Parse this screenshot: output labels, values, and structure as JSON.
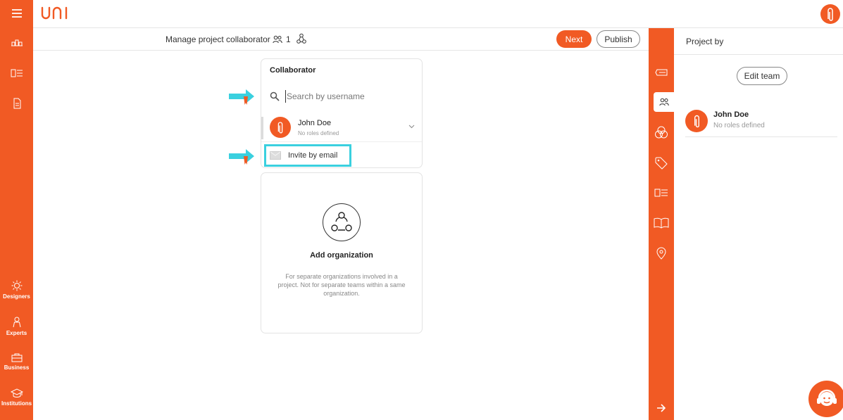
{
  "app": {
    "logo_text": "uni"
  },
  "left_rail": {
    "items": [
      {
        "label": "Designers"
      },
      {
        "label": "Experts"
      },
      {
        "label": "Business"
      },
      {
        "label": "Institutions"
      }
    ]
  },
  "subbar": {
    "title": "Manage project collaborator",
    "collaborator_count": "1",
    "next_label": "Next",
    "publish_label": "Publish"
  },
  "collaborator_card": {
    "title": "Collaborator",
    "search_placeholder": "Search by username",
    "member": {
      "name": "John Doe",
      "role": "No roles defined"
    },
    "invite_label": "Invite by email"
  },
  "org_card": {
    "title": "Add organization",
    "description": "For separate organizations involved in a project. Not for separate teams within a same organization."
  },
  "right_panel": {
    "title": "Project by",
    "edit_team_label": "Edit team",
    "member": {
      "name": "John Doe",
      "role": "No roles defined"
    }
  },
  "colors": {
    "brand": "#f15a24",
    "highlight": "#3ad0df"
  }
}
